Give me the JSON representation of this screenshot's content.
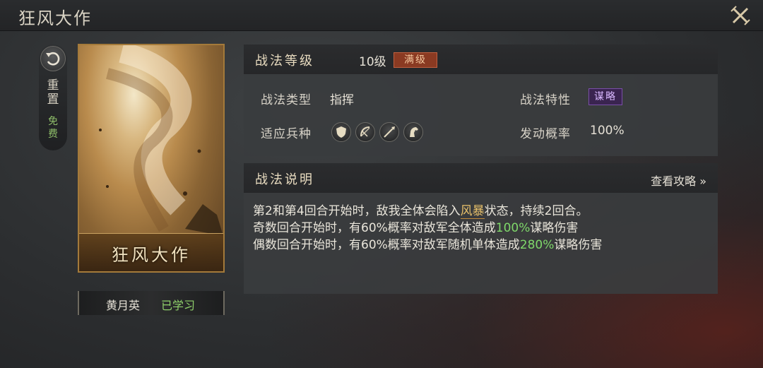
{
  "header": {
    "title": "狂风大作"
  },
  "reset": {
    "label_1": "重",
    "label_2": "置",
    "free_1": "免",
    "free_2": "费"
  },
  "card": {
    "name": "狂风大作"
  },
  "owner": {
    "name": "黄月英",
    "status": "已学习"
  },
  "level_panel": {
    "title": "战法等级",
    "level": "10级",
    "max_badge": "满级",
    "type_label": "战法类型",
    "type_value": "指挥",
    "trait_label": "战法特性",
    "trait_value": "谋略",
    "troops_label": "适应兵种",
    "troop_icons": [
      "shield-icon",
      "bow-icon",
      "spear-icon",
      "horse-icon"
    ],
    "chance_label": "发动概率",
    "chance_value": "100%"
  },
  "desc_panel": {
    "title": "战法说明",
    "guide_link": "查看攻略 »",
    "line1_a": "第2和第4回合开始时，敌我全体会陷入",
    "line1_hl": "风暴",
    "line1_b": "状态，持续2回合。",
    "line2_a": "奇数回合开始时，有60%概率对敌军全体造成",
    "line2_hl": "100%",
    "line2_b": "谋略伤害",
    "line3_a": "偶数回合开始时，有60%概率对敌军随机单体造成",
    "line3_hl": "280%",
    "line3_b": "谋略伤害"
  },
  "colors": {
    "accent_gold": "#e8c06a",
    "highlight_green": "#7fd86a",
    "trait_purple": "#7a4ea8",
    "max_red": "#8a3a22"
  }
}
